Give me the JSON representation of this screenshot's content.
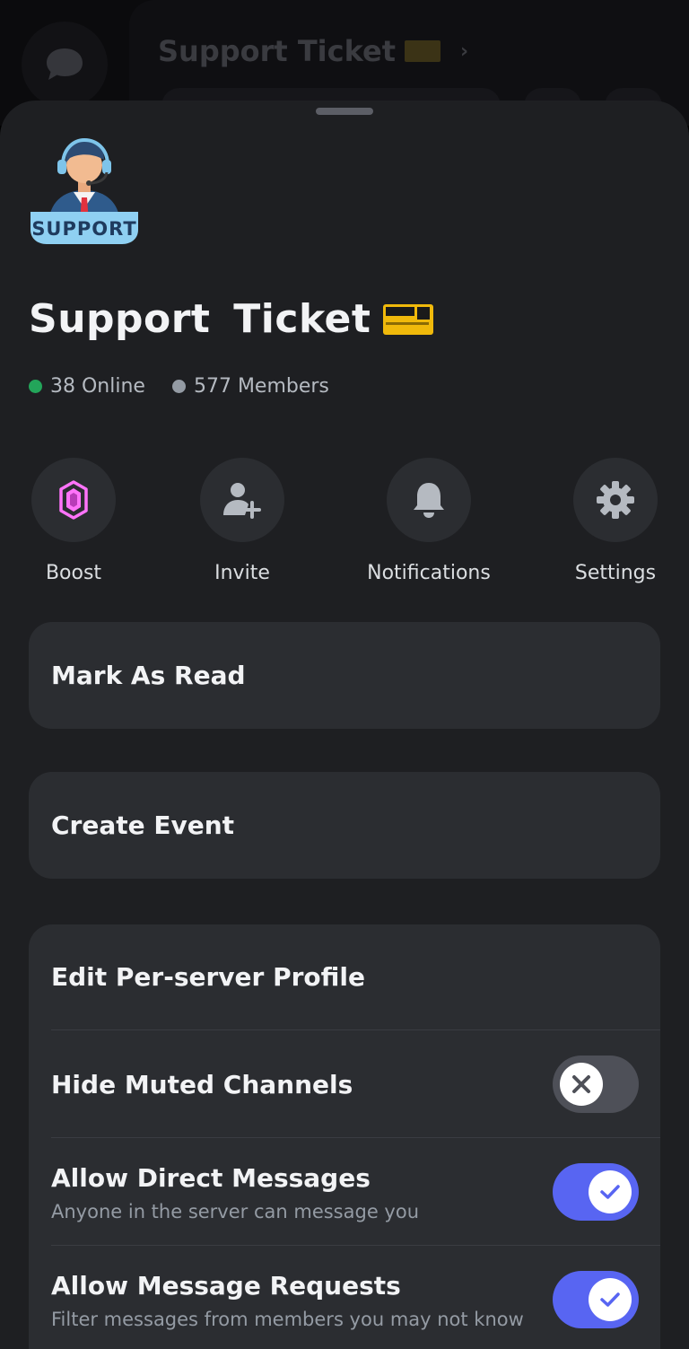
{
  "background": {
    "title": "Support  Ticket",
    "dm_icon": "chat-bubble-icon",
    "chevron_icon": "chevron-right-icon"
  },
  "server": {
    "icon": "support-agent-icon",
    "icon_label": "SUPPORT",
    "name": "Support  Ticket",
    "emoji": "ticket-emoji",
    "online": "38 Online",
    "members": "577 Members",
    "online_color": "#23a55a",
    "members_color": "#949ba4"
  },
  "actions": [
    {
      "label": "Boost",
      "icon": "boost-gem-icon",
      "color": "#ff73fa"
    },
    {
      "label": "Invite",
      "icon": "add-person-icon",
      "color": "#b5bac1"
    },
    {
      "label": "Notifications",
      "icon": "bell-icon",
      "color": "#b5bac1"
    },
    {
      "label": "Settings",
      "icon": "gear-icon",
      "color": "#b5bac1"
    }
  ],
  "menu": {
    "mark_as_read": "Mark As Read",
    "create_event": "Create Event"
  },
  "settings": {
    "edit_profile": "Edit Per-server Profile",
    "hide_muted": {
      "label": "Hide Muted Channels",
      "enabled": false
    },
    "allow_dms": {
      "label": "Allow Direct Messages",
      "sub": "Anyone in the server can message you",
      "enabled": true
    },
    "allow_requests": {
      "label": "Allow Message Requests",
      "sub": "Filter messages from members you may not know",
      "enabled": true
    }
  },
  "colors": {
    "accent": "#5865f2",
    "sheet": "#1e1f22",
    "card": "#2b2d31"
  }
}
